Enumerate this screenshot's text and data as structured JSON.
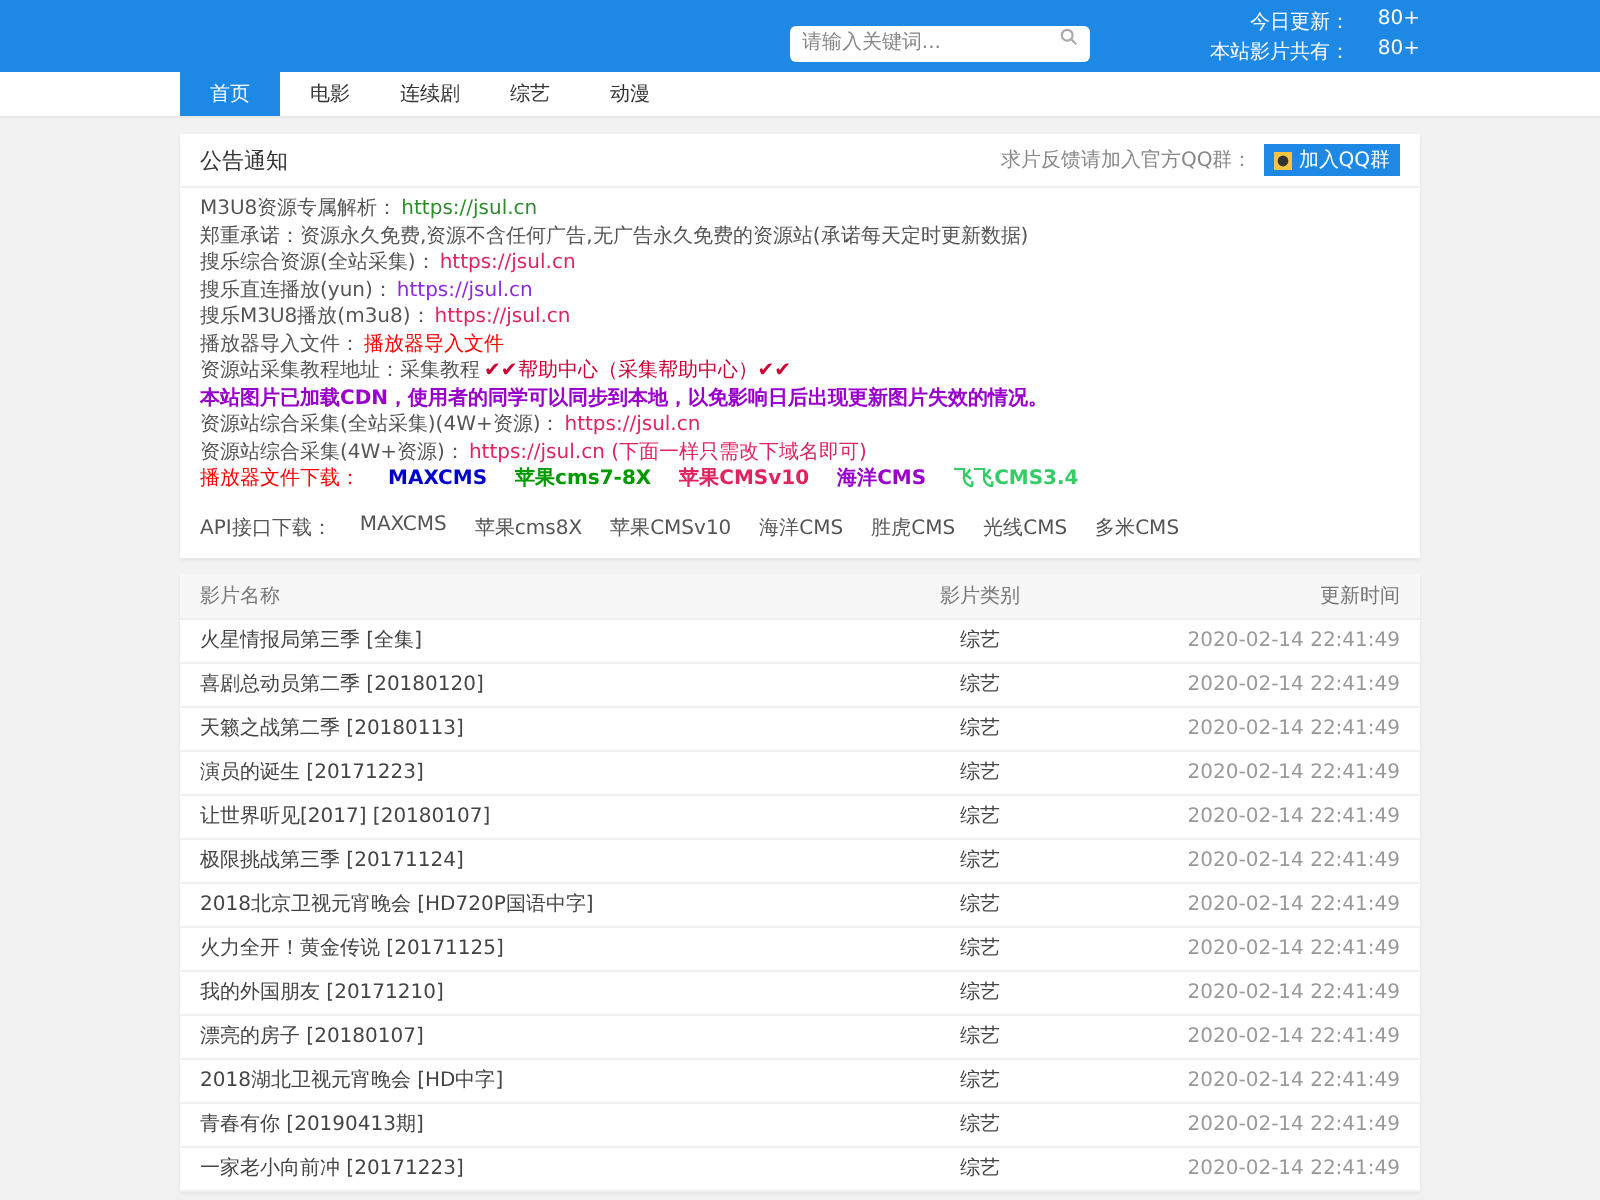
{
  "header": {
    "search": {
      "placeholder": "请输入关键词..."
    },
    "stats": [
      {
        "label": "今日更新：",
        "value": "80+"
      },
      {
        "label": "本站影片共有：",
        "value": "80+"
      }
    ]
  },
  "nav": [
    {
      "label": "首页",
      "selected": true
    },
    {
      "label": "电影",
      "selected": false
    },
    {
      "label": "连续剧",
      "selected": false
    },
    {
      "label": "综艺",
      "selected": false
    },
    {
      "label": "动漫",
      "selected": false
    }
  ],
  "notice": {
    "title": "公告通知",
    "qq_hint": "求片反馈请加入官方QQ群：",
    "qq_button": "加入QQ群",
    "lines": [
      {
        "kind": "pair",
        "label": "M3U8资源专属解析：",
        "link": "https://jsul.cn",
        "color": "#2e8b2e"
      },
      {
        "kind": "plain",
        "text": "郑重承诺：资源永久免费,资源不含任何广告,无广告永久免费的资源站(承诺每天定时更新数据)"
      },
      {
        "kind": "pair",
        "label": "搜乐综合资源(全站采集)：",
        "link": "https://jsul.cn",
        "color": "#e0245e"
      },
      {
        "kind": "pair",
        "label": "搜乐直连播放(yun)：",
        "link": "https://jsul.cn",
        "color": "#8a2be2"
      },
      {
        "kind": "pair",
        "label": "搜乐M3U8播放(m3u8)：",
        "link": "https://jsul.cn",
        "color": "#e0245e"
      },
      {
        "kind": "pair",
        "label": "播放器导入文件：",
        "link": "播放器导入文件",
        "color": "#ff0000"
      },
      {
        "kind": "pair",
        "label": "资源站采集教程地址：采集教程",
        "link": "✔✔帮助中心（采集帮助中心）✔✔",
        "color": "#cc0033"
      },
      {
        "kind": "strong",
        "text": "本站图片已加载CDN，使用者的同学可以同步到本地，以免影响日后出现更新图片失效的情况。",
        "color": "#9900cc"
      },
      {
        "kind": "pair",
        "label": "资源站综合采集(全站采集)(4W+资源)：",
        "link": "https://jsul.cn",
        "color": "#e0245e"
      },
      {
        "kind": "pair",
        "label": "资源站综合采集(4W+资源)：",
        "link": "https://jsul.cn (下面一样只需改下域名即可)",
        "color": "#e0245e"
      }
    ],
    "downloads": {
      "label": "播放器文件下载：",
      "items": [
        {
          "text": "MAXCMS",
          "color": "#0000cc"
        },
        {
          "text": "苹果cms7-8X",
          "color": "#009900"
        },
        {
          "text": "苹果CMSv10",
          "color": "#e0245e"
        },
        {
          "text": "海洋CMS",
          "color": "#9900cc"
        },
        {
          "text": "飞飞CMS3.4",
          "color": "#33cc66"
        }
      ]
    },
    "api": {
      "label": "API接口下载：",
      "items": [
        "MAXCMS",
        "苹果cms8X",
        "苹果CMSv10",
        "海洋CMS",
        "胜虎CMS",
        "光线CMS",
        "多米CMS"
      ]
    }
  },
  "table": {
    "columns": [
      "影片名称",
      "影片类别",
      "更新时间"
    ],
    "rows": [
      [
        "火星情报局第三季 [全集]",
        "综艺",
        "2020-02-14 22:41:49"
      ],
      [
        "喜剧总动员第二季 [20180120]",
        "综艺",
        "2020-02-14 22:41:49"
      ],
      [
        "天籁之战第二季 [20180113]",
        "综艺",
        "2020-02-14 22:41:49"
      ],
      [
        "演员的诞生 [20171223]",
        "综艺",
        "2020-02-14 22:41:49"
      ],
      [
        "让世界听见[2017] [20180107]",
        "综艺",
        "2020-02-14 22:41:49"
      ],
      [
        "极限挑战第三季 [20171124]",
        "综艺",
        "2020-02-14 22:41:49"
      ],
      [
        "2018北京卫视元宵晚会 [HD720P国语中字]",
        "综艺",
        "2020-02-14 22:41:49"
      ],
      [
        "火力全开！黄金传说 [20171125]",
        "综艺",
        "2020-02-14 22:41:49"
      ],
      [
        "我的外国朋友 [20171210]",
        "综艺",
        "2020-02-14 22:41:49"
      ],
      [
        "漂亮的房子 [20180107]",
        "综艺",
        "2020-02-14 22:41:49"
      ],
      [
        "2018湖北卫视元宵晚会 [HD中字]",
        "综艺",
        "2020-02-14 22:41:49"
      ],
      [
        "青春有你 [20190413期]",
        "综艺",
        "2020-02-14 22:41:49"
      ],
      [
        "一家老小向前冲 [20171223]",
        "综艺",
        "2020-02-14 22:41:49"
      ]
    ]
  }
}
